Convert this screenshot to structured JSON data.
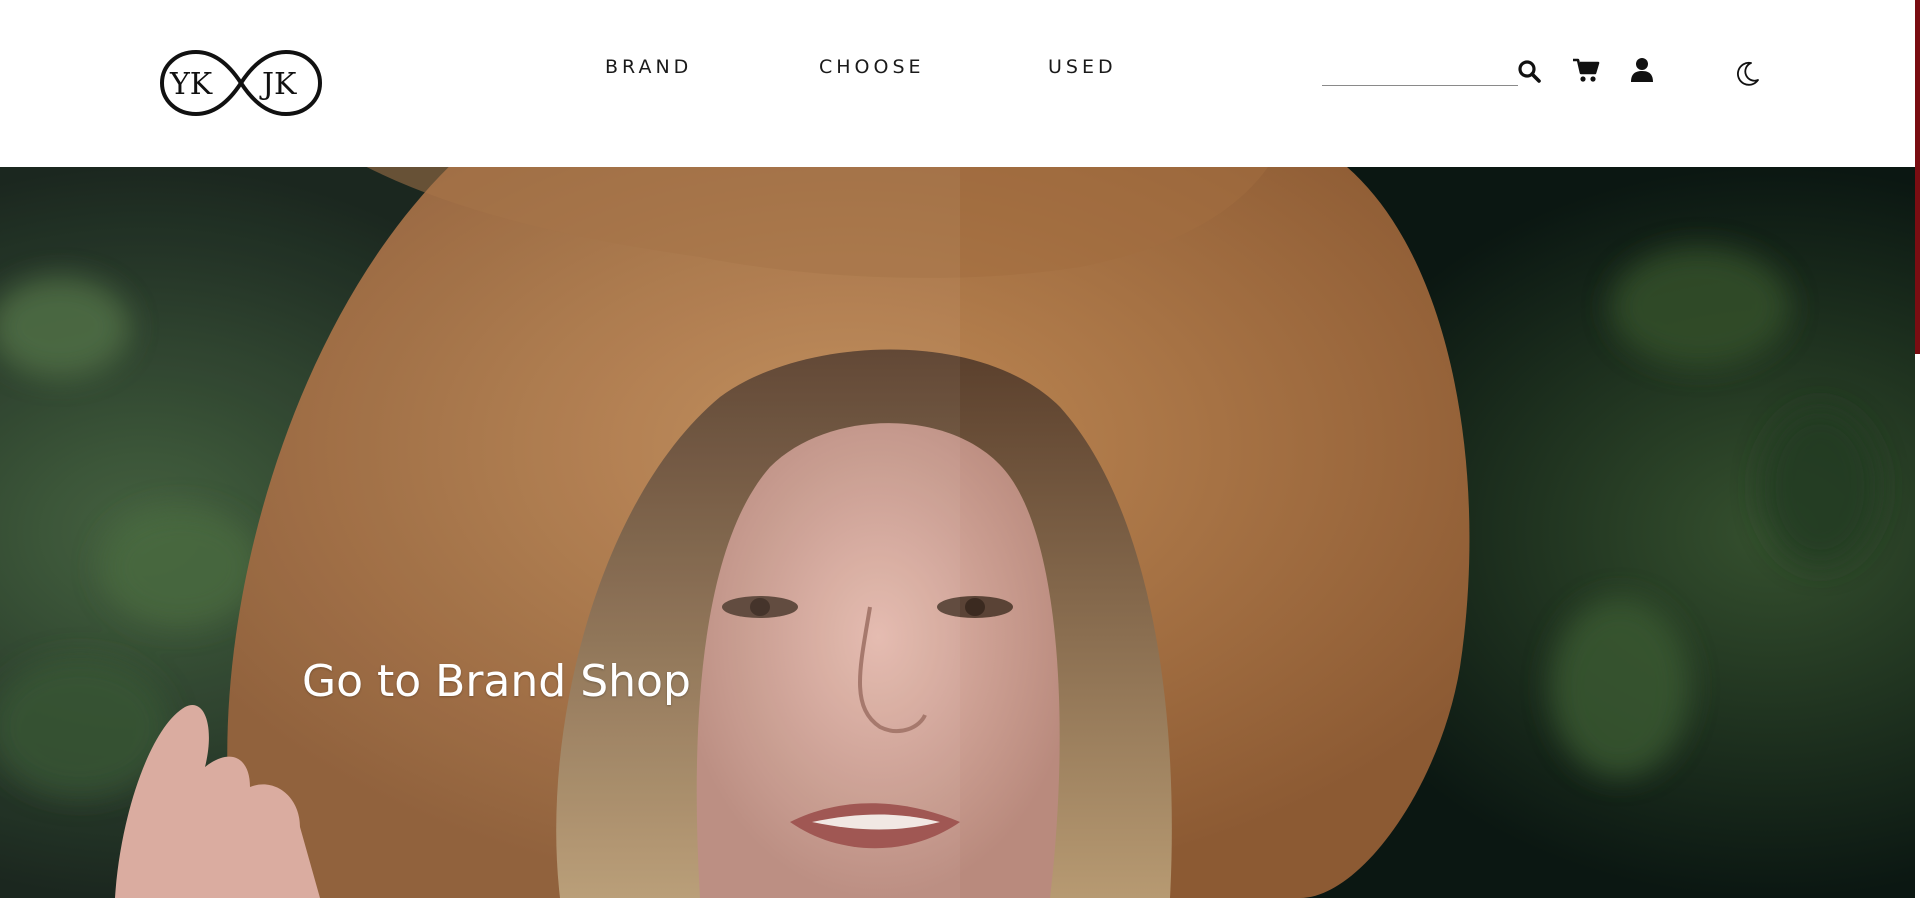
{
  "header": {
    "logo": {
      "left_text": "YK",
      "right_text": "JK",
      "icon": "infinity-logo"
    },
    "nav": [
      {
        "label": "BRAND"
      },
      {
        "label": "CHOOSE"
      },
      {
        "label": "USED"
      }
    ],
    "search": {
      "value": "",
      "placeholder": ""
    },
    "icons": {
      "search": "search-icon",
      "cart": "cart-icon",
      "user": "user-icon",
      "theme": "moon-icon"
    }
  },
  "hero": {
    "cta_label": "Go to Brand Shop",
    "image": "woman-in-wide-brim-hat-photo"
  },
  "colors": {
    "header_bg": "#ffffff",
    "nav_text": "#1a1a1a",
    "hero_text": "#ffffff",
    "scroll_accent": "#7a0d12",
    "hat": "#b07a48",
    "foliage": "#1c3322"
  }
}
